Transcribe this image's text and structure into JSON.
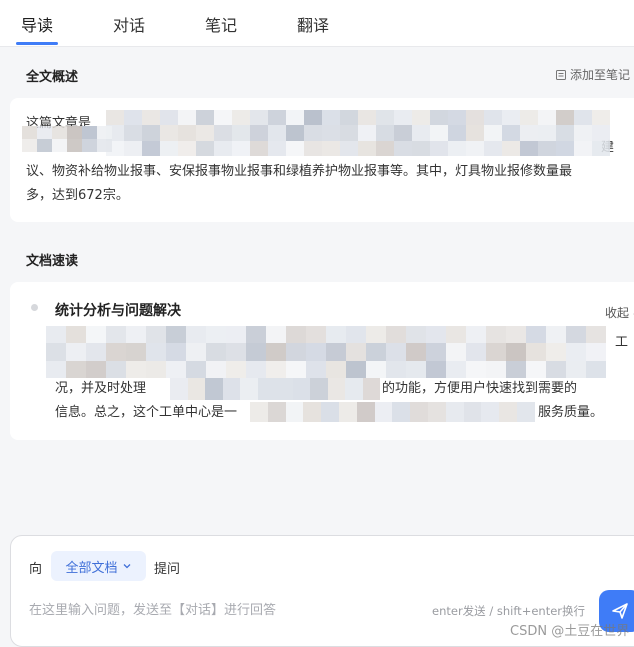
{
  "tabs": [
    {
      "label": "导读",
      "active": true
    },
    {
      "label": "对话",
      "active": false
    },
    {
      "label": "笔记",
      "active": false
    },
    {
      "label": "翻译",
      "active": false
    }
  ],
  "summary": {
    "title": "全文概述",
    "add_note_label": "添加至笔记",
    "line1_start": "这篇文章是",
    "line2_end": "建",
    "line3": "议、物资补给物业报事、安保报事物业报事和绿植养护物业报事等。其中，灯具物业报修数量最",
    "line4": "多，达到672宗。"
  },
  "quick_read": {
    "title": "文档速读",
    "item_title": "统计分析与问题解决",
    "collapse_label": "收起",
    "line1_end": "工",
    "line2_start": "况，并及时处理",
    "line2_end": "的功能，方便用户快速找到需要的",
    "line3_start": "信息。总之，这个工单中心是一",
    "line3_end": "服务质量。"
  },
  "composer": {
    "prefix": "向",
    "scope_label": "全部文档",
    "suffix": "提问",
    "placeholder": "在这里输入问题，发送至【对话】进行回答",
    "hint": "enter发送 / shift+enter换行"
  },
  "watermark": "CSDN @土豆在世界",
  "colors": {
    "accent": "#3f7cf7",
    "scope_bg": "#ecf2fe"
  }
}
